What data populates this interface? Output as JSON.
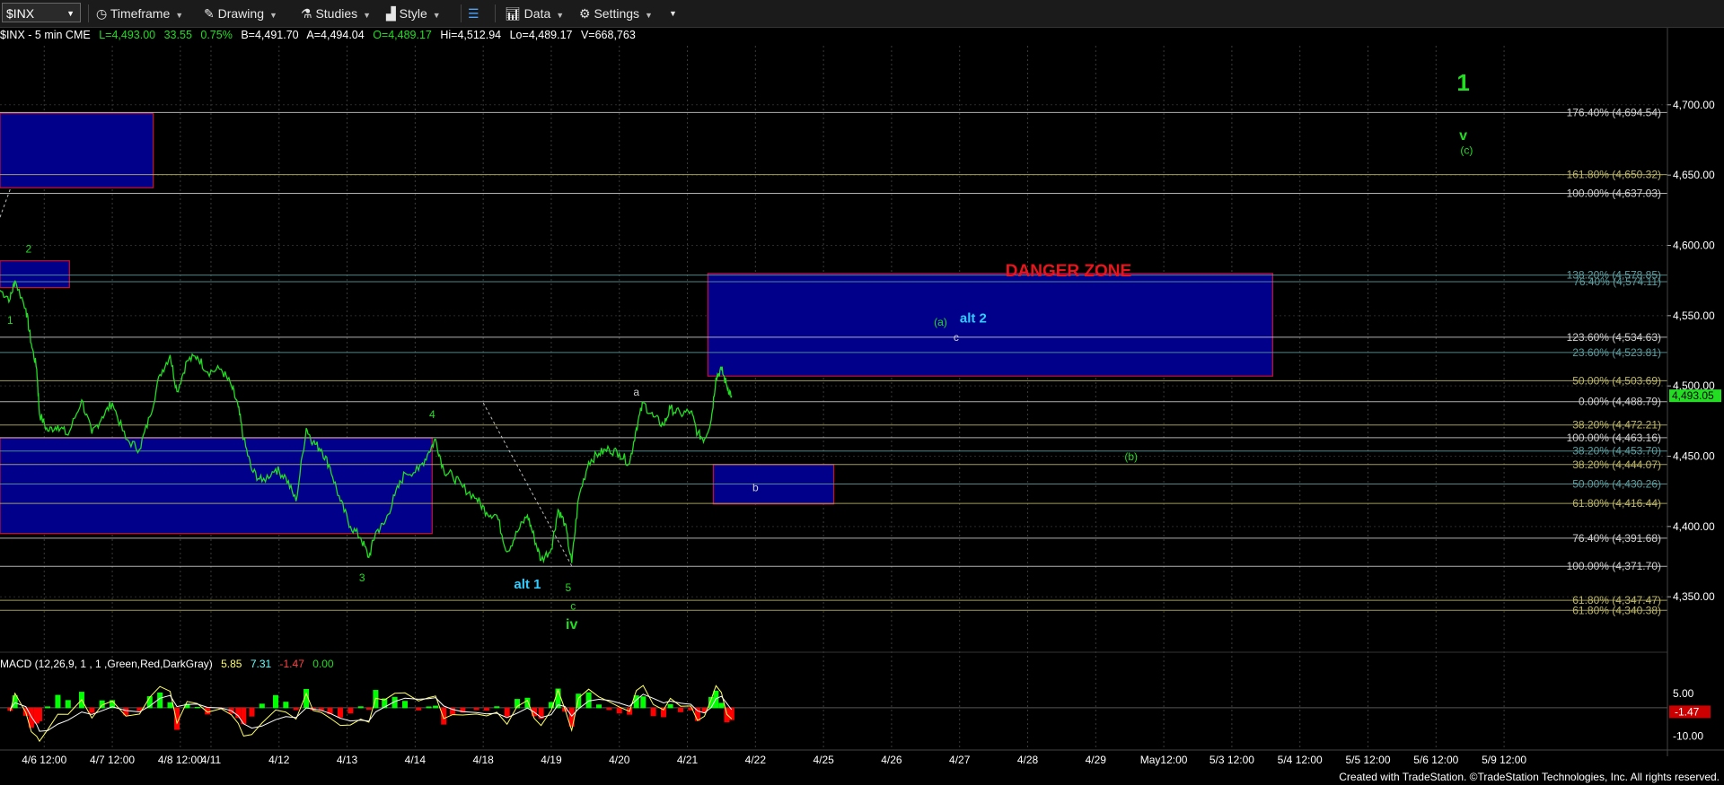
{
  "toolbar": {
    "symbol": "$INX",
    "timeframe_label": "Timeframe",
    "drawing_label": "Drawing",
    "studies_label": "Studies",
    "style_label": "Style",
    "data_label": "Data",
    "settings_label": "Settings"
  },
  "quote_line": {
    "title": "$INX - 5 min  CME",
    "last": "L=4,493.00",
    "change": "33.55",
    "change_pct": "0.75%",
    "bid": "B=4,491.70",
    "ask": "A=4,494.04",
    "open": "O=4,489.17",
    "high": "Hi=4,512.94",
    "low": "Lo=4,489.17",
    "volume": "V=668,763"
  },
  "footer": "Created with TradeStation. ©TradeStation Technologies, Inc. All rights reserved.",
  "colors": {
    "price": "#22dd22",
    "zone_fill": "#00008b",
    "zone_border": "#c8102e",
    "danger": "#e8161c",
    "axis_text": "#ffffff",
    "fib_olive": "#bdb76b",
    "fib_teal": "#5f9ea0",
    "fib_white": "#d0d0d0",
    "macd_line": "#ffff66",
    "signal_line": "#ffffff",
    "hist_pos": "#00ff00",
    "hist_neg": "#ff0000"
  },
  "chart_data": {
    "type": "line",
    "title": "$INX - 5 min",
    "y_ticks": [
      "4,700.00",
      "4,650.00",
      "4,600.00",
      "4,550.00",
      "4,500.00",
      "4,450.00",
      "4,400.00",
      "4,350.00"
    ],
    "y_tick_values": [
      4700,
      4650,
      4600,
      4550,
      4500,
      4450,
      4400,
      4350
    ],
    "ylim": [
      4308,
      4742
    ],
    "x_ticks": [
      "4/6 12:00",
      "4/7 12:00",
      "4/8 12:00",
      "4/11",
      "4/12",
      "4/13",
      "4/14",
      "4/18",
      "4/19",
      "4/20",
      "4/21",
      "4/22",
      "4/25",
      "4/26",
      "4/27",
      "4/28",
      "4/29",
      "May12:00",
      "5/3 12:00",
      "5/4 12:00",
      "5/5 12:00",
      "5/6 12:00",
      "5/9 12:00"
    ],
    "x_tick_values": [
      0.85,
      1.85,
      2.85,
      3.3,
      4.3,
      5.3,
      6.3,
      7.3,
      8.3,
      9.3,
      10.3,
      11.3,
      12.3,
      13.3,
      14.3,
      15.3,
      16.3,
      17.3,
      18.3,
      19.3,
      20.3,
      21.3,
      22.3
    ],
    "xlim": [
      0.2,
      24.7
    ],
    "last_price_label": "4,493.05",
    "price_series": [
      [
        0.2,
        4568
      ],
      [
        0.35,
        4562
      ],
      [
        0.42,
        4575
      ],
      [
        0.58,
        4555
      ],
      [
        0.66,
        4530
      ],
      [
        0.74,
        4512
      ],
      [
        0.78,
        4480
      ],
      [
        0.9,
        4468
      ],
      [
        1.05,
        4472
      ],
      [
        1.2,
        4465
      ],
      [
        1.4,
        4490
      ],
      [
        1.55,
        4466
      ],
      [
        1.7,
        4478
      ],
      [
        1.85,
        4488
      ],
      [
        2.05,
        4462
      ],
      [
        2.25,
        4455
      ],
      [
        2.4,
        4478
      ],
      [
        2.55,
        4508
      ],
      [
        2.7,
        4522
      ],
      [
        2.8,
        4496
      ],
      [
        2.95,
        4518
      ],
      [
        3.1,
        4521
      ],
      [
        3.25,
        4510
      ],
      [
        3.45,
        4512
      ],
      [
        3.6,
        4500
      ],
      [
        3.7,
        4485
      ],
      [
        3.78,
        4462
      ],
      [
        3.9,
        4440
      ],
      [
        4.05,
        4432
      ],
      [
        4.25,
        4441
      ],
      [
        4.4,
        4435
      ],
      [
        4.55,
        4418
      ],
      [
        4.7,
        4470
      ],
      [
        4.8,
        4460
      ],
      [
        4.92,
        4455
      ],
      [
        5.05,
        4442
      ],
      [
        5.2,
        4418
      ],
      [
        5.35,
        4400
      ],
      [
        5.5,
        4392
      ],
      [
        5.62,
        4378
      ],
      [
        5.72,
        4396
      ],
      [
        5.85,
        4402
      ],
      [
        6.0,
        4422
      ],
      [
        6.15,
        4438
      ],
      [
        6.35,
        4440
      ],
      [
        6.5,
        4453
      ],
      [
        6.6,
        4462
      ],
      [
        6.72,
        4440
      ],
      [
        6.85,
        4436
      ],
      [
        7.0,
        4428
      ],
      [
        7.2,
        4420
      ],
      [
        7.35,
        4410
      ],
      [
        7.5,
        4408
      ],
      [
        7.65,
        4382
      ],
      [
        7.8,
        4396
      ],
      [
        7.95,
        4408
      ],
      [
        8.05,
        4392
      ],
      [
        8.15,
        4376
      ],
      [
        8.3,
        4384
      ],
      [
        8.4,
        4412
      ],
      [
        8.5,
        4402
      ],
      [
        8.6,
        4374
      ],
      [
        8.7,
        4420
      ],
      [
        8.85,
        4446
      ],
      [
        9.0,
        4452
      ],
      [
        9.15,
        4455
      ],
      [
        9.3,
        4452
      ],
      [
        9.45,
        4445
      ],
      [
        9.55,
        4470
      ],
      [
        9.65,
        4488
      ],
      [
        9.8,
        4478
      ],
      [
        9.95,
        4472
      ],
      [
        10.05,
        4484
      ],
      [
        10.2,
        4480
      ],
      [
        10.35,
        4482
      ],
      [
        10.45,
        4466
      ],
      [
        10.55,
        4462
      ],
      [
        10.65,
        4476
      ],
      [
        10.72,
        4506
      ],
      [
        10.8,
        4512
      ],
      [
        10.88,
        4500
      ],
      [
        10.95,
        4493
      ]
    ],
    "zones": [
      {
        "x1": 0.2,
        "x2": 2.45,
        "y1": 4694,
        "y2": 4641
      },
      {
        "x1": 0.2,
        "x2": 1.22,
        "y1": 4589,
        "y2": 4570
      },
      {
        "x1": 0.2,
        "x2": 6.55,
        "y1": 4463,
        "y2": 4395
      },
      {
        "x1": 10.6,
        "x2": 18.9,
        "y1": 4580,
        "y2": 4507
      },
      {
        "x1": 10.68,
        "x2": 12.45,
        "y1": 4444,
        "y2": 4416
      }
    ],
    "zone_text": "DANGER ZONE",
    "fib_levels": [
      {
        "label": "176.40% (4,694.54)",
        "value": 4694.54,
        "color": "#d0d0d0"
      },
      {
        "label": "161.80% (4,650.32)",
        "value": 4650.32,
        "color": "#bdb76b"
      },
      {
        "label": "100.00% (4,637.03)",
        "value": 4637.03,
        "color": "#d0d0d0"
      },
      {
        "label": "138.20% (4,578.85)",
        "value": 4578.85,
        "color": "#5f9ea0"
      },
      {
        "label": "76.40% (4,574.11)",
        "value": 4574.11,
        "color": "#5f9ea0"
      },
      {
        "label": "123.60% (4,534.63)",
        "value": 4534.63,
        "color": "#d0d0d0"
      },
      {
        "label": "23.60% (4,523.81)",
        "value": 4523.81,
        "color": "#5f9ea0"
      },
      {
        "label": "50.00% (4,503.69)",
        "value": 4503.69,
        "color": "#bdb76b"
      },
      {
        "label": "0.00% (4,488.79)",
        "value": 4488.79,
        "color": "#d0d0d0"
      },
      {
        "label": "38.20% (4,472.21)",
        "value": 4472.21,
        "color": "#bdb76b"
      },
      {
        "label": "100.00% (4,463.16)",
        "value": 4463.16,
        "color": "#d0d0d0"
      },
      {
        "label": "38.20% (4,453.70)",
        "value": 4453.7,
        "color": "#5f9ea0"
      },
      {
        "label": "38.20% (4,444.07)",
        "value": 4444.07,
        "color": "#bdb76b"
      },
      {
        "label": "50.00% (4,430.26)",
        "value": 4430.26,
        "color": "#5f9ea0"
      },
      {
        "label": "61.80% (4,416.44)",
        "value": 4416.44,
        "color": "#bdb76b"
      },
      {
        "label": "76.40% (4,391.68)",
        "value": 4391.68,
        "color": "#d0d0d0"
      },
      {
        "label": "100.00% (4,371.70)",
        "value": 4371.7,
        "color": "#d0d0d0"
      },
      {
        "label": "61.80% (4,347.47)",
        "value": 4347.47,
        "color": "#bdb76b"
      },
      {
        "label": "61.80% (4,340.38)",
        "value": 4340.38,
        "color": "#bdb76b"
      }
    ],
    "wave_labels": [
      {
        "text": "1",
        "x": 0.35,
        "y": 4544,
        "color": "#22dd22"
      },
      {
        "text": "2",
        "x": 0.62,
        "y": 4595,
        "color": "#22dd22"
      },
      {
        "text": "3",
        "x": 5.52,
        "y": 4361,
        "color": "#22dd22"
      },
      {
        "text": "4",
        "x": 6.55,
        "y": 4477,
        "color": "#22dd22"
      },
      {
        "text": "alt 1",
        "x": 7.95,
        "y": 4356,
        "color": "#33ccff"
      },
      {
        "text": "5",
        "x": 8.55,
        "y": 4354,
        "color": "#22dd22"
      },
      {
        "text": "c",
        "x": 8.62,
        "y": 4341,
        "color": "#22dd22"
      },
      {
        "text": "iv",
        "x": 8.6,
        "y": 4327,
        "color": "#22dd22"
      },
      {
        "text": "a",
        "x": 9.55,
        "y": 4493,
        "color": "#d0d0d0"
      },
      {
        "text": "b",
        "x": 11.3,
        "y": 4425,
        "color": "#d0d0d0"
      },
      {
        "text": "(a)",
        "x": 14.02,
        "y": 4543,
        "color": "#22dd22"
      },
      {
        "text": "alt 2",
        "x": 14.5,
        "y": 4545,
        "color": "#33ccff"
      },
      {
        "text": "c",
        "x": 14.25,
        "y": 4532,
        "color": "#d0d0d0"
      },
      {
        "text": "(b)",
        "x": 16.82,
        "y": 4447,
        "color": "#22dd22"
      },
      {
        "text": "1",
        "x": 21.7,
        "y": 4710,
        "color": "#22dd22"
      },
      {
        "text": "v",
        "x": 21.7,
        "y": 4675,
        "color": "#22dd22"
      },
      {
        "text": "(c)",
        "x": 21.75,
        "y": 4665,
        "color": "#22dd22"
      }
    ],
    "macd": {
      "label": "MACD (12,26,9, 1 , 1 ,Green,Red,DarkGray)",
      "macd_value": "5.85",
      "signal_value": "7.31",
      "diff_value": "-1.47",
      "zero_value": "0.00",
      "y_ticks": [
        "5.00",
        "-10.00"
      ],
      "y_tick_values": [
        5,
        -10
      ],
      "ylim": [
        -14,
        12
      ],
      "last_value_label": "-1.47"
    }
  }
}
